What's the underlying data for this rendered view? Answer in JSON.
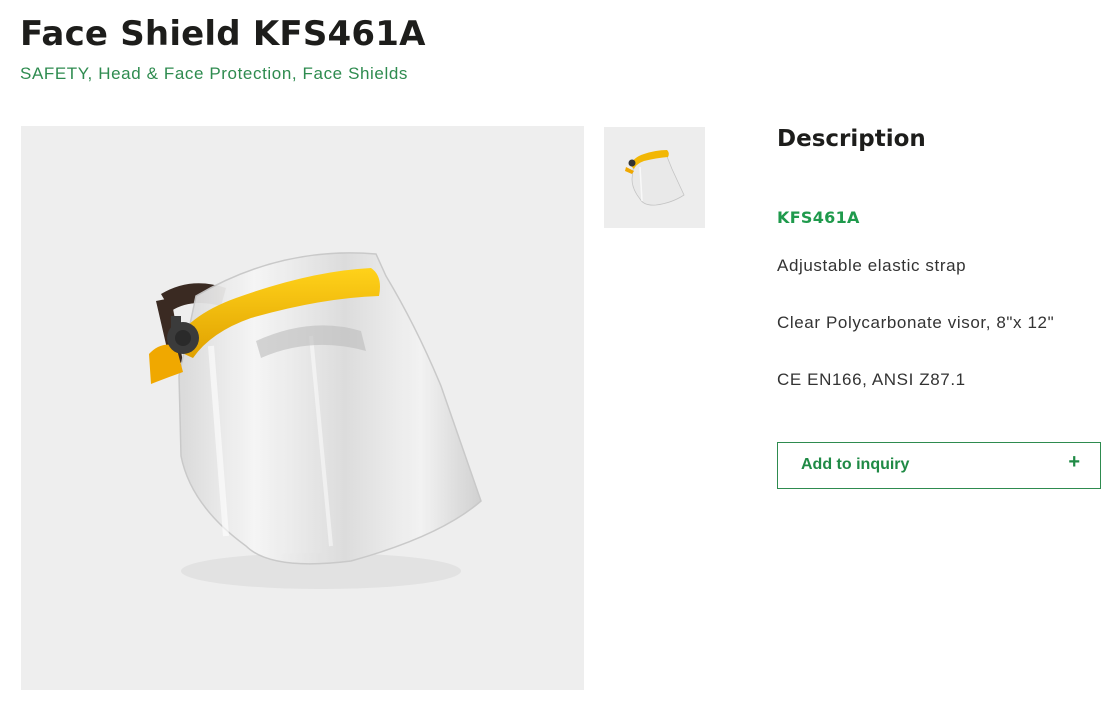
{
  "product": {
    "title": "Face Shield KFS461A",
    "breadcrumb": [
      "SAFETY",
      "Head & Face Protection",
      "Face Shields"
    ],
    "breadcrumb_separator": ", "
  },
  "description": {
    "heading": "Description",
    "sku": "KFS461A",
    "features": [
      "Adjustable elastic strap",
      "Clear Polycarbonate visor, 8\"x 12\"",
      "CE EN166, ANSI Z87.1"
    ]
  },
  "inquiry": {
    "label": "Add to inquiry",
    "icon": "+"
  },
  "colors": {
    "accent_green": "#2e8b4f",
    "image_bg": "#eeeeee",
    "headband_yellow": "#f2b705"
  }
}
